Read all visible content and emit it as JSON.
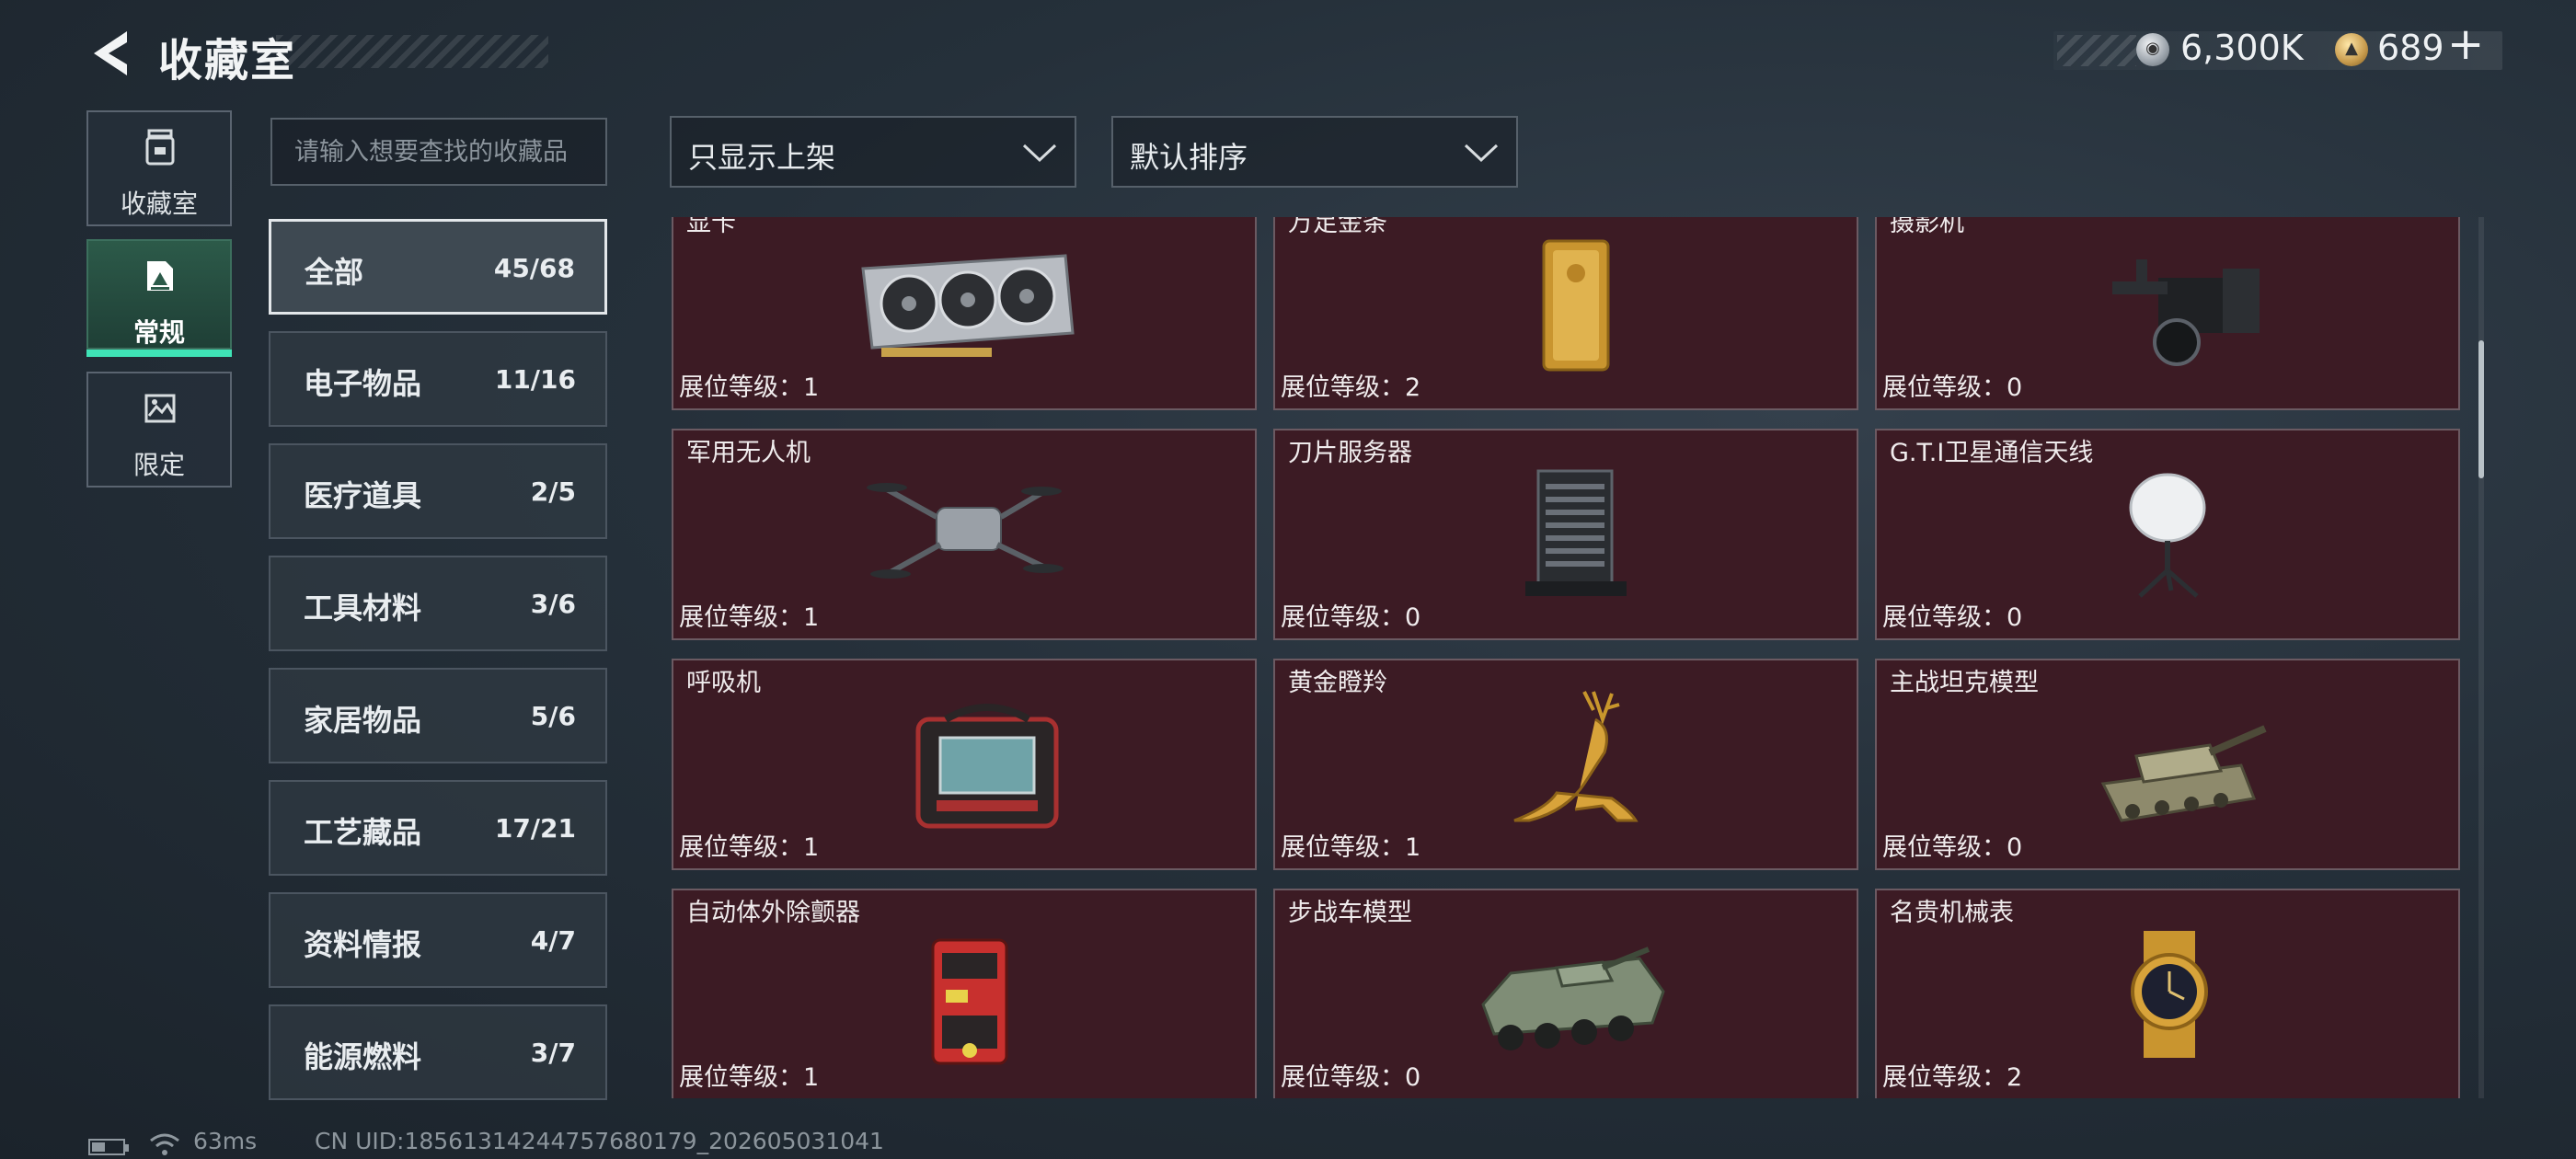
{
  "header": {
    "title": "收藏室",
    "currency_silver": "6,300K",
    "currency_gold": "689",
    "plus_label": "+"
  },
  "nav": {
    "tabs": [
      {
        "label": "收藏室",
        "icon": "jar-icon"
      },
      {
        "label": "常规",
        "icon": "photo-icon",
        "active": true
      },
      {
        "label": "限定",
        "icon": "image-icon"
      }
    ]
  },
  "search": {
    "placeholder": "请输入想要查找的收藏品"
  },
  "filters": {
    "display": "只显示上架",
    "sort": "默认排序"
  },
  "categories": [
    {
      "name": "全部",
      "count": "45/68",
      "active": true
    },
    {
      "name": "电子物品",
      "count": "11/16"
    },
    {
      "name": "医疗道具",
      "count": "2/5"
    },
    {
      "name": "工具材料",
      "count": "3/6"
    },
    {
      "name": "家居物品",
      "count": "5/6"
    },
    {
      "name": "工艺藏品",
      "count": "17/21"
    },
    {
      "name": "资料情报",
      "count": "4/7"
    },
    {
      "name": "能源燃料",
      "count": "3/7"
    }
  ],
  "items": [
    {
      "name": "显卡",
      "level": "展位等级：1",
      "icon": "graphics-card-icon"
    },
    {
      "name": "万足金条",
      "level": "展位等级：2",
      "icon": "gold-bar-icon"
    },
    {
      "name": "摄影机",
      "level": "展位等级：0",
      "icon": "video-camera-icon"
    },
    {
      "name": "军用无人机",
      "level": "展位等级：1",
      "icon": "drone-icon"
    },
    {
      "name": "刀片服务器",
      "level": "展位等级：0",
      "icon": "server-icon"
    },
    {
      "name": "G.T.I卫星通信天线",
      "level": "展位等级：0",
      "icon": "satellite-dish-icon"
    },
    {
      "name": "呼吸机",
      "level": "展位等级：1",
      "icon": "ventilator-icon"
    },
    {
      "name": "黄金瞪羚",
      "level": "展位等级：1",
      "icon": "gold-gazelle-icon"
    },
    {
      "name": "主战坦克模型",
      "level": "展位等级：0",
      "icon": "tank-icon"
    },
    {
      "name": "自动体外除颤器",
      "level": "展位等级：1",
      "icon": "defibrillator-icon"
    },
    {
      "name": "步战车模型",
      "level": "展位等级：0",
      "icon": "ifv-icon"
    },
    {
      "name": "名贵机械表",
      "level": "展位等级：2",
      "icon": "watch-icon"
    }
  ],
  "status": {
    "ping": "63ms",
    "uid": "CN UID:18561314244757680179_202605031041"
  },
  "colors": {
    "accent": "#3fe3b6",
    "card_bg": "#3c1b24",
    "active_tab": "#2c5a49"
  }
}
